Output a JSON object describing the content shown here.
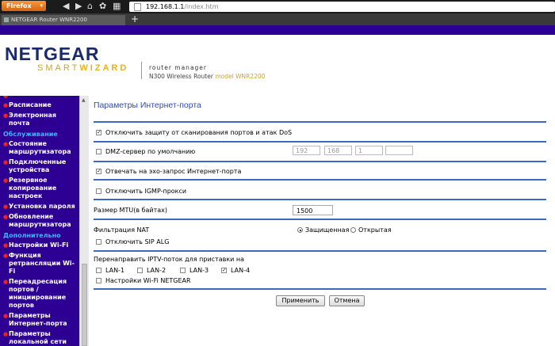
{
  "browser": {
    "menu_label": "Firefox",
    "url_host": "192.168.1.1",
    "url_path": "/index.htm",
    "tab_title": "NETGEAR Router WNR2200",
    "new_tab": "+"
  },
  "header": {
    "brand": "NETGEAR",
    "product_light": "SMART",
    "product_bold": "WIZARD",
    "subtitle": "router manager",
    "model_line": "N300 Wireless Router",
    "model_name": "model WNR2200"
  },
  "sidebar": {
    "items_top": [
      "Расписание",
      "Электронная почта"
    ],
    "group_maintenance": "Обслуживание",
    "items_maintenance": [
      "Состояние маршрутизатора",
      "Подключенные устройства",
      "Резервное копирование настроек",
      "Установка пароля",
      "Обновление маршрутизатора"
    ],
    "group_advanced": "Дополнительно",
    "items_advanced": [
      "Настройки Wi-Fi",
      "Функция ретрансляции Wi-Fi",
      "Переадресация портов / инициирование портов",
      "Параметры Интернет-порта",
      "Параметры локальной сети"
    ]
  },
  "main": {
    "title": "Параметры Интернет-порта",
    "dos_label": "Отключить защиту от сканирования портов и атак DoS",
    "dos_checked": true,
    "dmz_label": "DMZ-сервер по умолчанию",
    "dmz_checked": false,
    "dmz_ip": [
      "192",
      "168",
      "1",
      ""
    ],
    "ping_label": "Отвечать на эхо-запрос Интернет-порта",
    "ping_checked": true,
    "igmp_label": "Отключить IGMP-прокси",
    "igmp_checked": false,
    "mtu_label": "Размер MTU(в байтах)",
    "mtu_value": "1500",
    "nat_label": "Фильтрация NAT",
    "nat_options": [
      "Защищенная",
      "Открытая"
    ],
    "nat_selected": "Защищенная",
    "sip_label": "Отключить SIP ALG",
    "sip_checked": false,
    "iptv_label": "Перенаправить IPTV-поток для приставки на",
    "lan_labels": [
      "LAN-1",
      "LAN-2",
      "LAN-3",
      "LAN-4"
    ],
    "lan_checked": [
      false,
      false,
      false,
      true
    ],
    "wifi_label": "Настройки Wi-Fi NETGEAR",
    "wifi_checked": false,
    "apply_label": "Применить",
    "cancel_label": "Отмена"
  },
  "colors": {
    "sidebar_bg": "#2d0093",
    "group_text": "#39b7ff",
    "bullet": "#f02020",
    "title_text": "#2d4bb5",
    "rule": "#3a6ac4"
  }
}
